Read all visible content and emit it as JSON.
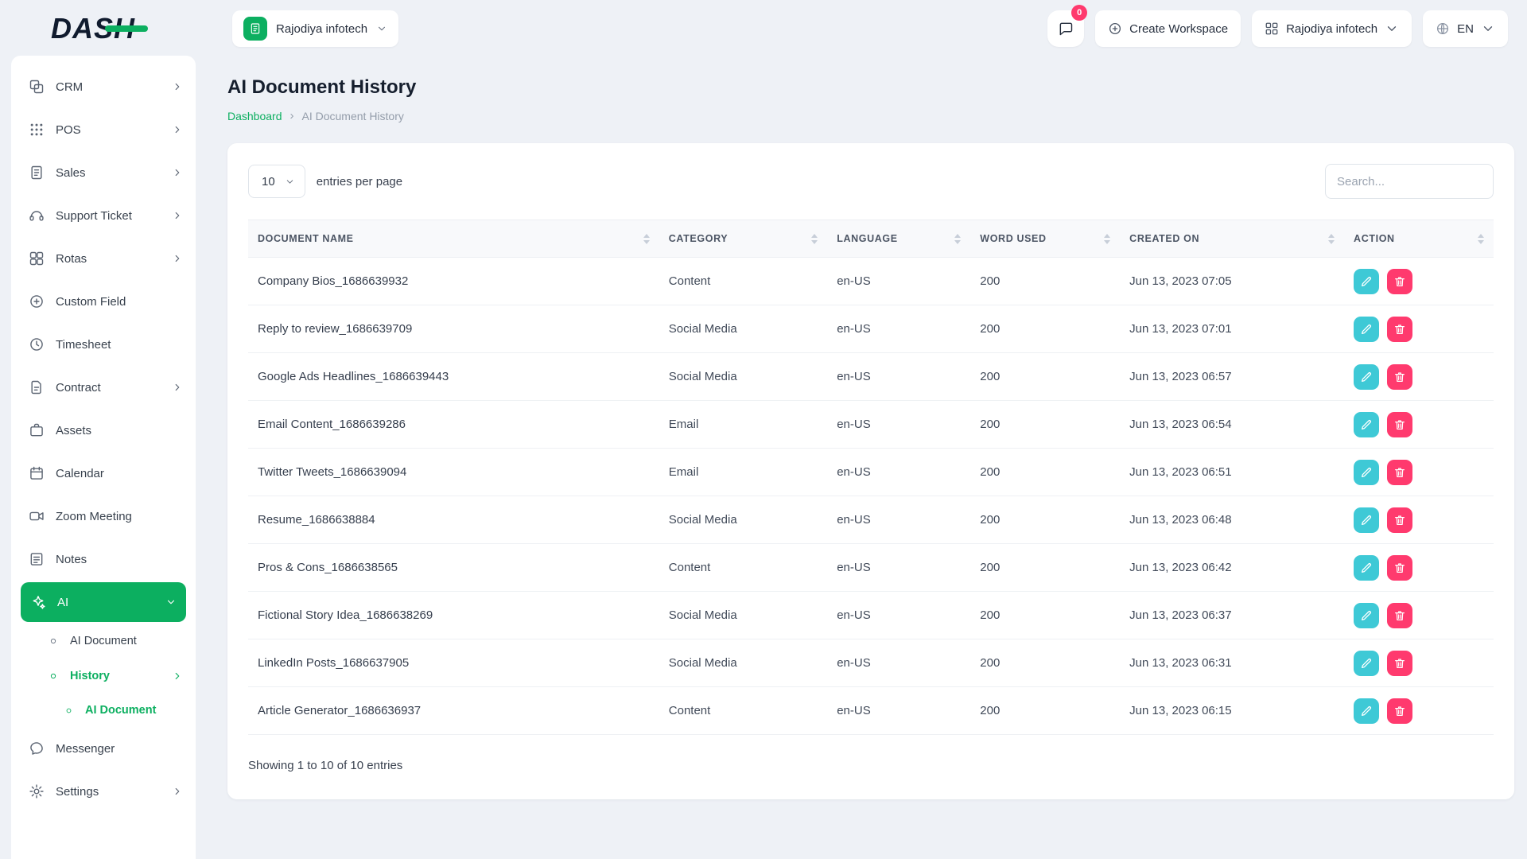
{
  "colors": {
    "accent": "#0caf60",
    "info": "#3ec9d6",
    "danger": "#ff3a6e"
  },
  "brand": {
    "logo_text": "DASH"
  },
  "header": {
    "workspace_selector_label": "Rajodiya infotech",
    "messages_badge": "0",
    "create_workspace_label": "Create Workspace",
    "company_menu_label": "Rajodiya infotech",
    "language_label": "EN"
  },
  "sidebar": {
    "items": [
      {
        "label": "CRM",
        "icon": "crm",
        "chevron": "right",
        "level": 0
      },
      {
        "label": "POS",
        "icon": "pos",
        "chevron": "right",
        "level": 0
      },
      {
        "label": "Sales",
        "icon": "sales",
        "chevron": "right",
        "level": 0
      },
      {
        "label": "Support Ticket",
        "icon": "support-ticket",
        "chevron": "right",
        "level": 0
      },
      {
        "label": "Rotas",
        "icon": "rotas",
        "chevron": "right",
        "level": 0
      },
      {
        "label": "Custom Field",
        "icon": "custom-field",
        "chevron": "",
        "level": 0
      },
      {
        "label": "Timesheet",
        "icon": "timesheet",
        "chevron": "",
        "level": 0
      },
      {
        "label": "Contract",
        "icon": "contract",
        "chevron": "right",
        "level": 0
      },
      {
        "label": "Assets",
        "icon": "assets",
        "chevron": "",
        "level": 0
      },
      {
        "label": "Calendar",
        "icon": "calendar",
        "chevron": "",
        "level": 0
      },
      {
        "label": "Zoom Meeting",
        "icon": "zoom-meeting",
        "chevron": "",
        "level": 0
      },
      {
        "label": "Notes",
        "icon": "notes",
        "chevron": "",
        "level": 0
      },
      {
        "label": "AI",
        "icon": "ai",
        "chevron": "down",
        "level": 0,
        "active": true
      },
      {
        "label": "AI Document",
        "icon": "dot",
        "chevron": "",
        "level": 1
      },
      {
        "label": "History",
        "icon": "dot",
        "chevron": "right",
        "level": 1,
        "active": true
      },
      {
        "label": "AI Document",
        "icon": "dot",
        "chevron": "",
        "level": 2,
        "active": true
      },
      {
        "label": "Messenger",
        "icon": "messenger",
        "chevron": "",
        "level": 0
      },
      {
        "label": "Settings",
        "icon": "settings",
        "chevron": "right",
        "level": 0
      }
    ]
  },
  "page": {
    "title": "AI Document History",
    "breadcrumb": {
      "home": "Dashboard",
      "current": "AI Document History"
    }
  },
  "controls": {
    "page_size": "10",
    "entries_label": "entries per page",
    "search_placeholder": "Search..."
  },
  "table": {
    "columns": [
      "DOCUMENT NAME",
      "CATEGORY",
      "LANGUAGE",
      "WORD USED",
      "CREATED ON",
      "ACTION"
    ],
    "rows": [
      {
        "name": "Company Bios_1686639932",
        "category": "Content",
        "language": "en-US",
        "words": "200",
        "created": "Jun 13, 2023 07:05"
      },
      {
        "name": "Reply to review_1686639709",
        "category": "Social Media",
        "language": "en-US",
        "words": "200",
        "created": "Jun 13, 2023 07:01"
      },
      {
        "name": "Google Ads Headlines_1686639443",
        "category": "Social Media",
        "language": "en-US",
        "words": "200",
        "created": "Jun 13, 2023 06:57"
      },
      {
        "name": "Email Content_1686639286",
        "category": "Email",
        "language": "en-US",
        "words": "200",
        "created": "Jun 13, 2023 06:54"
      },
      {
        "name": "Twitter Tweets_1686639094",
        "category": "Email",
        "language": "en-US",
        "words": "200",
        "created": "Jun 13, 2023 06:51"
      },
      {
        "name": "Resume_1686638884",
        "category": "Social Media",
        "language": "en-US",
        "words": "200",
        "created": "Jun 13, 2023 06:48"
      },
      {
        "name": "Pros & Cons_1686638565",
        "category": "Content",
        "language": "en-US",
        "words": "200",
        "created": "Jun 13, 2023 06:42"
      },
      {
        "name": "Fictional Story Idea_1686638269",
        "category": "Social Media",
        "language": "en-US",
        "words": "200",
        "created": "Jun 13, 2023 06:37"
      },
      {
        "name": "LinkedIn Posts_1686637905",
        "category": "Social Media",
        "language": "en-US",
        "words": "200",
        "created": "Jun 13, 2023 06:31"
      },
      {
        "name": "Article Generator_1686636937",
        "category": "Content",
        "language": "en-US",
        "words": "200",
        "created": "Jun 13, 2023 06:15"
      }
    ]
  },
  "table_footer": {
    "showing_text": "Showing 1 to 10 of 10 entries"
  }
}
